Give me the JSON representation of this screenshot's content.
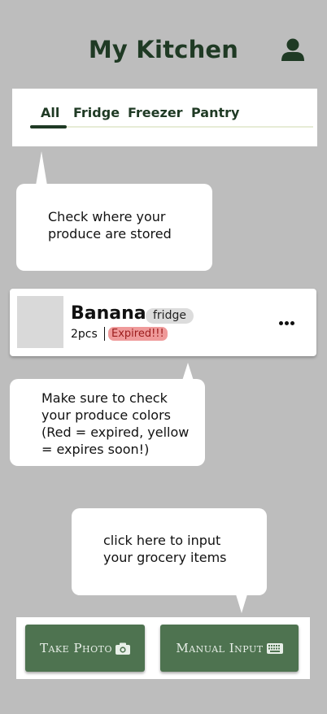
{
  "header": {
    "title": "My Kitchen",
    "profile_icon": "user-icon"
  },
  "tabs": [
    {
      "label": "All",
      "active": true
    },
    {
      "label": "Fridge",
      "active": false
    },
    {
      "label": "Freezer",
      "active": false
    },
    {
      "label": "Pantry",
      "active": false
    }
  ],
  "tooltips": {
    "storage": [
      "Check where your",
      "produce are stored"
    ],
    "colors": [
      "Make sure to check",
      "your produce colors",
      "(Red = expired, yellow",
      "= expires soon!)"
    ],
    "input": [
      "click here to input",
      "your grocery items"
    ]
  },
  "item": {
    "name": "Banana",
    "location": "fridge",
    "quantity": "2pcs",
    "status": "Expired!!!",
    "status_color": "#ef9a9a",
    "menu_icon": "more-horizontal-icon"
  },
  "actions": {
    "take_photo": "Take Photo",
    "take_photo_icon": "camera-icon",
    "manual_input": "Manual Input",
    "manual_input_icon": "keyboard-icon"
  },
  "colors": {
    "background": "#bdbdbd",
    "brand_dark_green": "#1f3a24",
    "button_green": "#4e7350"
  }
}
